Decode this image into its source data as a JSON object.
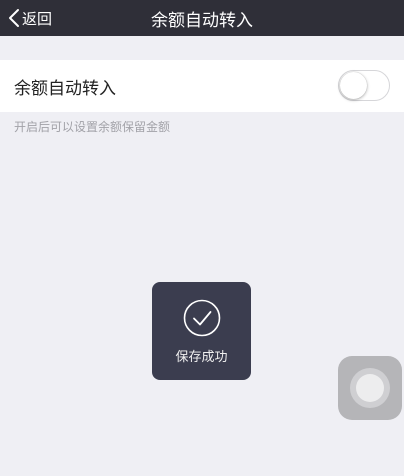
{
  "navbar": {
    "back_label": "返回",
    "title": "余额自动转入"
  },
  "setting": {
    "label": "余额自动转入",
    "toggle_on": false,
    "hint": "开启后可以设置余额保留金额"
  },
  "toast": {
    "icon": "check-circle-icon",
    "text": "保存成功"
  },
  "assistive_touch": {
    "icon": "assistive-touch-icon"
  },
  "colors": {
    "navbar_bg": "#2f2f38",
    "page_bg": "#efeff4",
    "toast_bg": "#3b3d4f",
    "hint_text": "#a2a2a8"
  }
}
